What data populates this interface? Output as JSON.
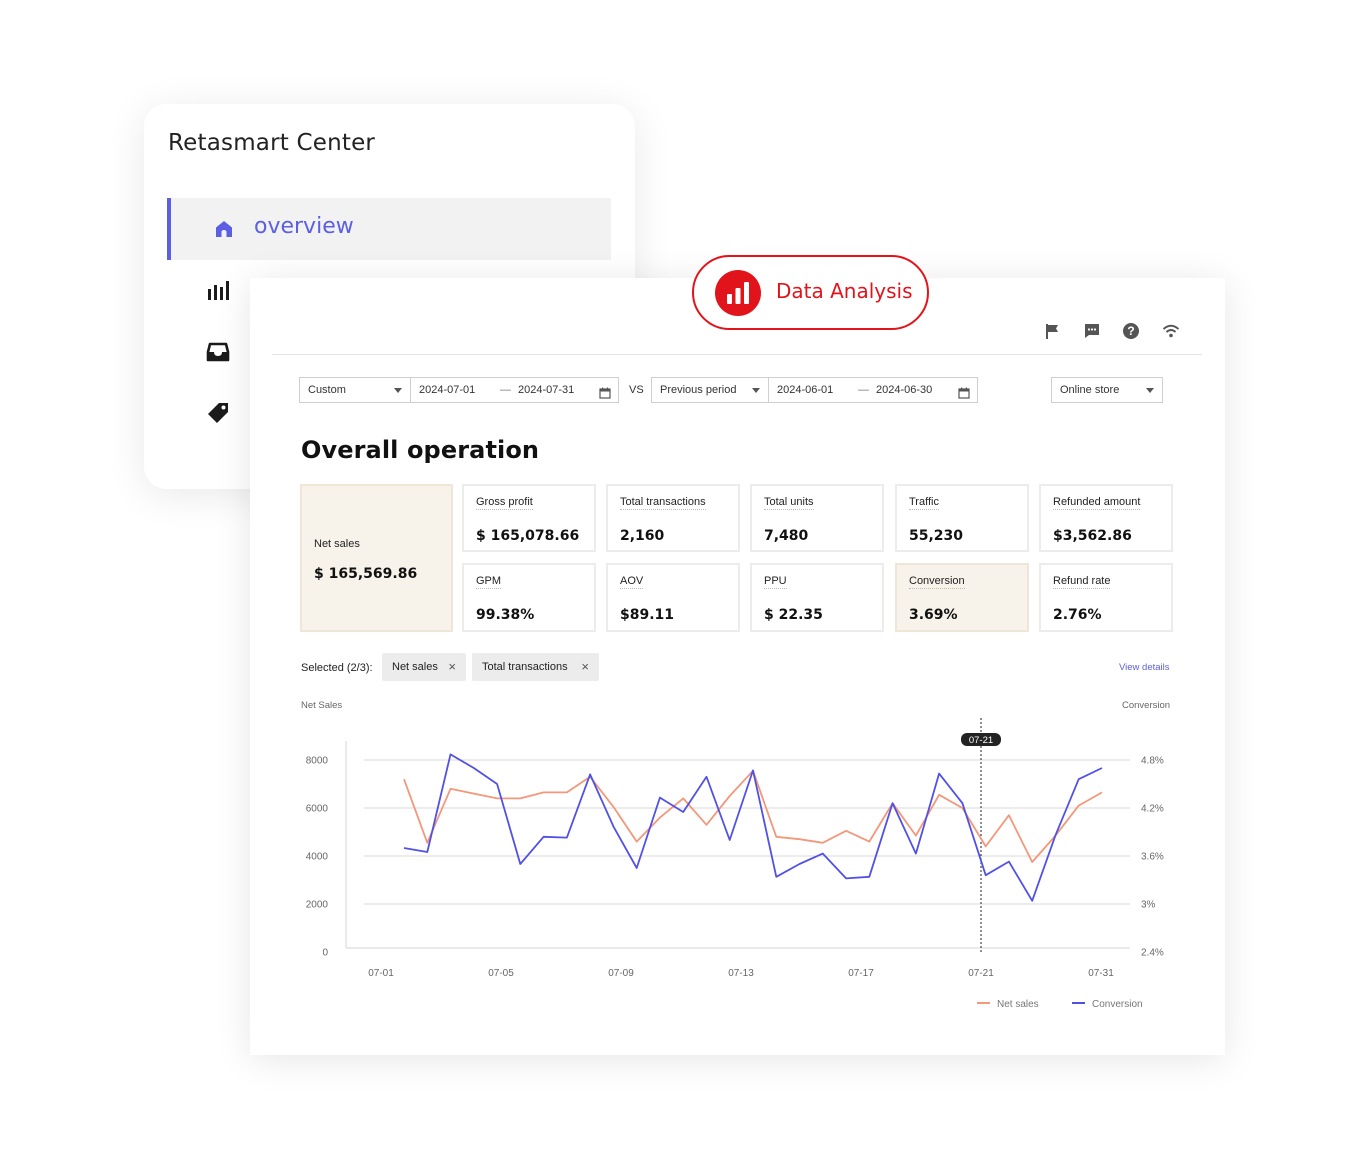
{
  "sidebar": {
    "title": "Retasmart Center",
    "active_item": "overview",
    "icons": [
      "home-icon",
      "bar-chart-icon",
      "inbox-icon",
      "tag-icon"
    ],
    "accent_color": "#5b5fe3"
  },
  "badge": {
    "label": "Data Analysis",
    "color": "#e2141b",
    "icon": "bar-chart-icon"
  },
  "topbar": {
    "icons": [
      "flag-icon",
      "message-icon",
      "help-icon",
      "wifi-icon"
    ]
  },
  "filters": {
    "mode": "Custom",
    "start": "2024-07-01",
    "end": "2024-07-31",
    "vs": "VS",
    "compare_mode": "Previous period",
    "compare_start": "2024-06-01",
    "compare_end": "2024-06-30",
    "channel": "Online store",
    "separator": "—"
  },
  "heading": "Overall operation",
  "kpis": {
    "net_sales": {
      "label": "Net sales",
      "value": "$ 165,569.86"
    },
    "gross_profit": {
      "label": "Gross profit",
      "value": "$ 165,078.66"
    },
    "total_transactions": {
      "label": "Total transactions",
      "value": "2,160"
    },
    "total_units": {
      "label": "Total units",
      "value": "7,480"
    },
    "traffic": {
      "label": "Traffic",
      "value": "55,230"
    },
    "refunded_amount": {
      "label": "Refunded amount",
      "value": "$3,562.86"
    },
    "gpm": {
      "label": "GPM",
      "value": "99.38%"
    },
    "aov": {
      "label": "AOV",
      "value": "$89.11"
    },
    "ppu": {
      "label": "PPU",
      "value": "$ 22.35"
    },
    "conversion": {
      "label": "Conversion",
      "value": "3.69%"
    },
    "refund_rate": {
      "label": "Refund rate",
      "value": "2.76%"
    }
  },
  "selection": {
    "label": "Selected (2/3):",
    "chips": [
      "Net sales",
      "Total transactions"
    ],
    "view_details": "View details"
  },
  "chart_data": {
    "type": "line",
    "ylabel": "Net Sales",
    "y2label": "Conversion",
    "ylim": [
      0,
      8000
    ],
    "y2lim": [
      2.4,
      4.8
    ],
    "yticks": [
      "0",
      "2000",
      "4000",
      "6000",
      "8000"
    ],
    "y2ticks": [
      "2.4%",
      "3%",
      "3.6%",
      "4.2%",
      "4.8%"
    ],
    "xticks": [
      "07-01",
      "07-05",
      "07-09",
      "07-13",
      "07-17",
      "07-21",
      "07-31"
    ],
    "x": [
      "07-01",
      "07-02",
      "07-03",
      "07-04",
      "07-05",
      "07-06",
      "07-07",
      "07-08",
      "07-09",
      "07-10",
      "07-11",
      "07-12",
      "07-13",
      "07-14",
      "07-15",
      "07-16",
      "07-17",
      "07-18",
      "07-19",
      "07-20",
      "07-21",
      "07-22",
      "07-23",
      "07-24",
      "07-25",
      "07-26",
      "07-27",
      "07-28",
      "07-29",
      "07-30",
      "07-31"
    ],
    "highlight": "07-21",
    "grid": true,
    "legend_position": "bottom-right",
    "series": [
      {
        "name": "Net sales",
        "axis": "left",
        "color": "#f4977a",
        "values": [
          7200,
          4550,
          6800,
          6600,
          6400,
          6400,
          6650,
          6650,
          7300,
          6050,
          4600,
          5600,
          6400,
          5300,
          6500,
          7550,
          4800,
          4700,
          4550,
          5050,
          4600,
          6200,
          4850,
          6550,
          6000,
          4400,
          5700,
          3750,
          4850,
          6100,
          6650
        ]
      },
      {
        "name": "Conversion",
        "axis": "right",
        "color": "#5151e6",
        "values": [
          3.7,
          3.65,
          4.87,
          4.7,
          4.5,
          3.5,
          3.84,
          3.83,
          4.62,
          3.97,
          3.45,
          4.33,
          4.15,
          4.59,
          3.8,
          4.67,
          3.34,
          3.5,
          3.63,
          3.32,
          3.34,
          4.26,
          3.63,
          4.63,
          4.26,
          3.36,
          3.53,
          3.04,
          3.86,
          4.56,
          4.7
        ]
      }
    ]
  }
}
